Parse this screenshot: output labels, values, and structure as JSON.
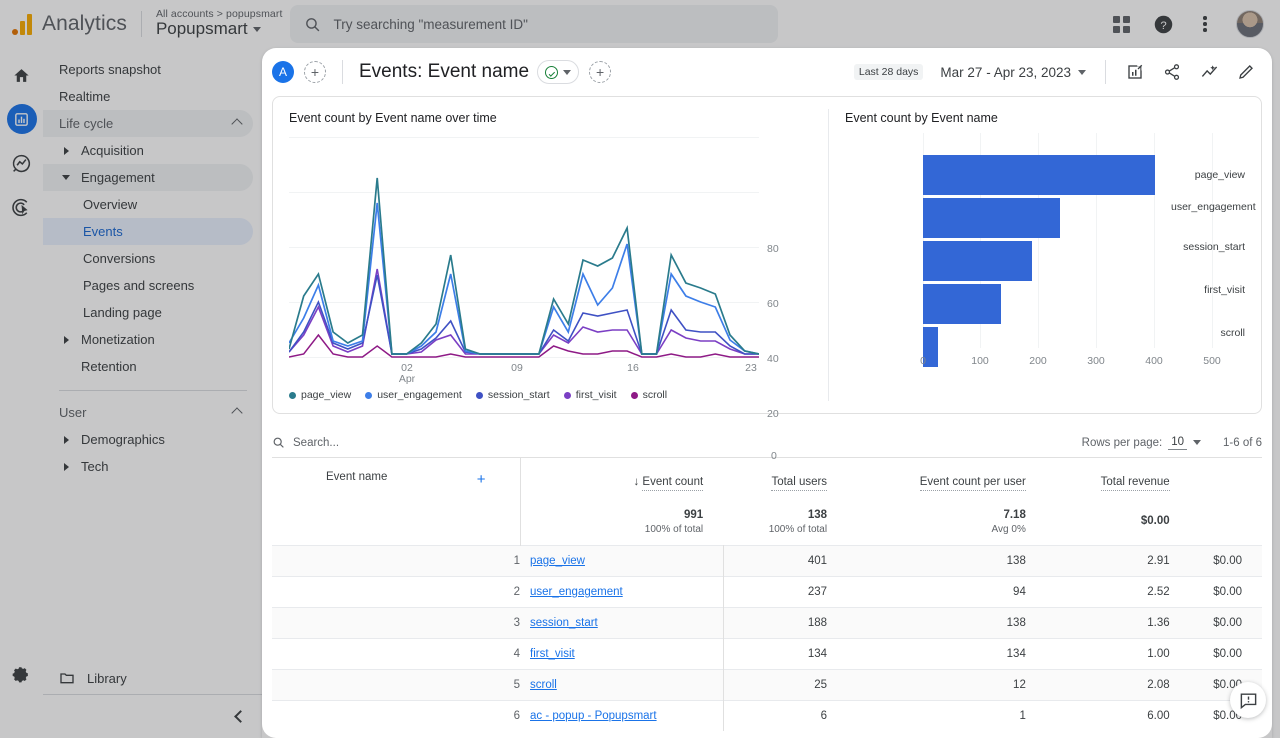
{
  "topbar": {
    "brand": "Analytics",
    "breadcrumb": "All accounts > popupsmart",
    "account_name": "Popupsmart",
    "search_placeholder": "Try searching \"measurement ID\"",
    "icons": {
      "apps": "apps-grid-icon",
      "help": "help-icon",
      "more": "more-vertical-icon",
      "avatar": "user-avatar"
    }
  },
  "rail": {
    "items": [
      {
        "name": "home-icon",
        "label": "Home",
        "active": false
      },
      {
        "name": "reports-icon",
        "label": "Reports",
        "active": true
      },
      {
        "name": "explore-icon",
        "label": "Explore",
        "active": false
      },
      {
        "name": "advertising-icon",
        "label": "Advertising",
        "active": false
      }
    ],
    "settings_label": "Admin"
  },
  "nav": {
    "items": [
      {
        "label": "Reports snapshot",
        "type": "item"
      },
      {
        "label": "Realtime",
        "type": "item"
      },
      {
        "label": "Life cycle",
        "type": "group",
        "expanded": true
      },
      {
        "label": "Acquisition",
        "type": "collapsed"
      },
      {
        "label": "Engagement",
        "type": "expanded"
      },
      {
        "label": "Overview",
        "type": "sub"
      },
      {
        "label": "Events",
        "type": "sub-selected"
      },
      {
        "label": "Conversions",
        "type": "sub"
      },
      {
        "label": "Pages and screens",
        "type": "sub"
      },
      {
        "label": "Landing page",
        "type": "sub"
      },
      {
        "label": "Monetization",
        "type": "collapsed"
      },
      {
        "label": "Retention",
        "type": "item"
      },
      {
        "label": "User",
        "type": "group",
        "expanded": true
      },
      {
        "label": "Demographics",
        "type": "collapsed"
      },
      {
        "label": "Tech",
        "type": "collapsed"
      }
    ],
    "library_label": "Library",
    "collapse_label": "Collapse navigation"
  },
  "report": {
    "chip_initial": "A",
    "add_comparison_label": "+",
    "title": "Events: Event name",
    "title_add_label": "+",
    "date_badge": "Last 28 days",
    "date_range": "Mar 27 - Apr 23, 2023",
    "toolbar_icons": [
      "compare-icon",
      "share-icon",
      "insights-icon",
      "edit-icon"
    ]
  },
  "chart_data": [
    {
      "type": "line",
      "title": "Event count by Event name over time",
      "xlabel": "",
      "ylabel": "",
      "ylim": [
        0,
        80
      ],
      "yticks": [
        0,
        20,
        40,
        60,
        80
      ],
      "xticks": [
        "02",
        "09",
        "16",
        "23"
      ],
      "xtick_sub": "Apr",
      "grid": true,
      "legend_position": "bottom",
      "series": [
        {
          "name": "page_view",
          "color": "#2a7b8c",
          "values": [
            3,
            22,
            30,
            9,
            5,
            8,
            65,
            1,
            1,
            5,
            12,
            37,
            3,
            1,
            1,
            1,
            1,
            1,
            21,
            12,
            35,
            33,
            36,
            47,
            1,
            1,
            37,
            27,
            25,
            23,
            8,
            2,
            1
          ]
        },
        {
          "name": "user_engagement",
          "color": "#3d7ee8",
          "values": [
            5,
            14,
            26,
            6,
            4,
            6,
            56,
            1,
            1,
            4,
            9,
            30,
            2,
            1,
            1,
            1,
            1,
            1,
            18,
            9,
            30,
            19,
            25,
            41,
            1,
            1,
            30,
            22,
            20,
            18,
            6,
            2,
            1
          ]
        },
        {
          "name": "session_start",
          "color": "#3f51c4",
          "values": [
            2,
            9,
            20,
            5,
            3,
            5,
            30,
            1,
            1,
            3,
            7,
            13,
            2,
            1,
            1,
            1,
            1,
            1,
            10,
            6,
            16,
            15,
            16,
            17,
            1,
            1,
            17,
            10,
            9,
            9,
            4,
            1,
            1
          ]
        },
        {
          "name": "first_visit",
          "color": "#7b3fc4",
          "values": [
            2,
            8,
            18,
            4,
            2,
            4,
            32,
            1,
            1,
            2,
            6,
            8,
            1,
            1,
            1,
            1,
            1,
            1,
            8,
            5,
            11,
            9,
            10,
            10,
            1,
            1,
            10,
            7,
            6,
            6,
            3,
            1,
            1
          ]
        },
        {
          "name": "scroll",
          "color": "#8e1a86",
          "values": [
            0,
            1,
            8,
            1,
            0,
            0,
            4,
            0,
            0,
            0,
            0,
            1,
            0,
            0,
            0,
            0,
            0,
            0,
            4,
            2,
            1,
            1,
            2,
            2,
            0,
            0,
            1,
            0,
            0,
            1,
            0,
            0,
            0
          ]
        }
      ]
    },
    {
      "type": "bar",
      "orientation": "horizontal",
      "title": "Event count by Event name",
      "categories": [
        "page_view",
        "user_engagement",
        "session_start",
        "first_visit",
        "scroll"
      ],
      "values": [
        401,
        237,
        188,
        134,
        25
      ],
      "xticks": [
        0,
        100,
        200,
        300,
        400,
        500
      ],
      "xlim": [
        0,
        500
      ],
      "bar_color": "#3367d6",
      "grid": true
    }
  ],
  "table": {
    "search_placeholder": "Search...",
    "rows_per_page_label": "Rows per page:",
    "rows_per_page_value": "10",
    "pagination": "1-6 of 6",
    "dimension_header": "Event name",
    "add_dimension_label": "+",
    "sort_indicator": "↓",
    "columns": [
      "Event count",
      "Total users",
      "Event count per user",
      "Total revenue"
    ],
    "totals": {
      "event_count": "991",
      "event_count_sub": "100% of total",
      "total_users": "138",
      "total_users_sub": "100% of total",
      "per_user": "7.18",
      "per_user_sub": "Avg 0%",
      "revenue": "$0.00",
      "revenue_sub": ""
    },
    "rows": [
      {
        "idx": "1",
        "name": "page_view",
        "event_count": "401",
        "total_users": "138",
        "per_user": "2.91",
        "revenue": "$0.00"
      },
      {
        "idx": "2",
        "name": "user_engagement",
        "event_count": "237",
        "total_users": "94",
        "per_user": "2.52",
        "revenue": "$0.00"
      },
      {
        "idx": "3",
        "name": "session_start",
        "event_count": "188",
        "total_users": "138",
        "per_user": "1.36",
        "revenue": "$0.00"
      },
      {
        "idx": "4",
        "name": "first_visit",
        "event_count": "134",
        "total_users": "134",
        "per_user": "1.00",
        "revenue": "$0.00"
      },
      {
        "idx": "5",
        "name": "scroll",
        "event_count": "25",
        "total_users": "12",
        "per_user": "2.08",
        "revenue": "$0.00"
      },
      {
        "idx": "6",
        "name": "ac - popup - Popupsmart",
        "event_count": "6",
        "total_users": "1",
        "per_user": "6.00",
        "revenue": "$0.00"
      }
    ]
  },
  "feedback": {
    "name": "feedback-icon",
    "label": "Send feedback"
  },
  "colors": {
    "accent": "#1a73e8",
    "bar": "#3367d6",
    "selected_bg": "#e8f0fe",
    "green": "#188038"
  }
}
